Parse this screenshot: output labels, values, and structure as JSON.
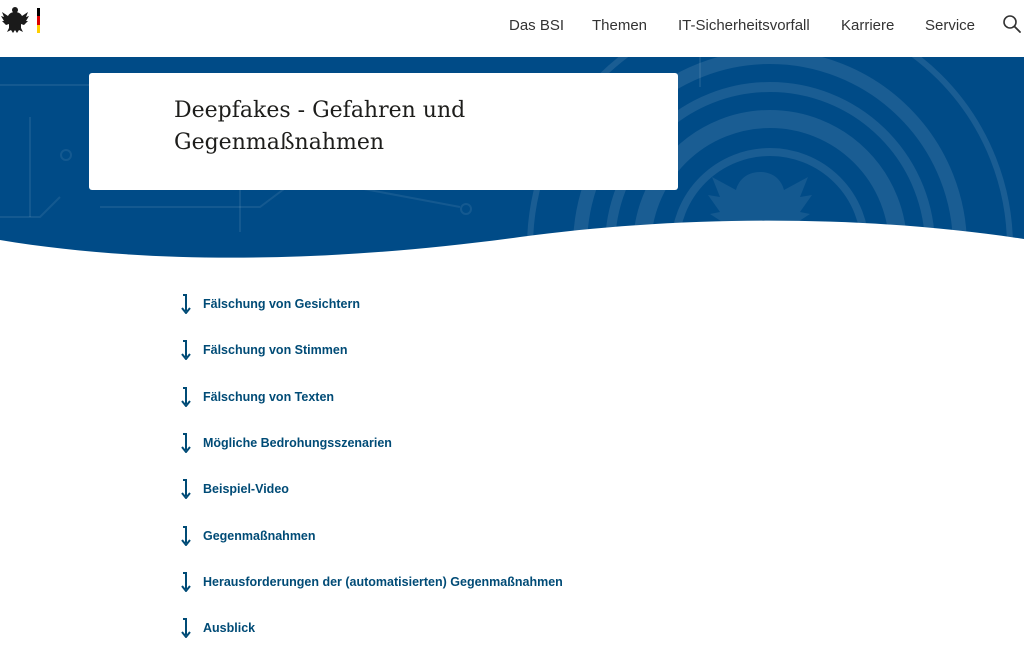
{
  "header": {
    "logo_icon": "federal-eagle-icon",
    "nav": [
      {
        "label": "Das BSI"
      },
      {
        "label": "Themen"
      },
      {
        "label": "IT-Sicherheitsvorfall"
      },
      {
        "label": "Karriere"
      },
      {
        "label": "Service"
      }
    ],
    "search_icon": "search-icon"
  },
  "hero": {
    "title": "Deepfakes - Gefahren und Gegenmaßnahmen",
    "background_color": "#004b87"
  },
  "anchors": {
    "arrow_icon": "arrow-down-icon",
    "color": "#004b76",
    "items": [
      {
        "label": "Fälschung von Gesichtern"
      },
      {
        "label": "Fälschung von Stimmen"
      },
      {
        "label": "Fälschung von Texten"
      },
      {
        "label": "Mögliche Bedrohungsszenarien"
      },
      {
        "label": "Beispiel-Video"
      },
      {
        "label": "Gegenmaßnahmen"
      },
      {
        "label": "Herausforderungen der (automatisierten) Gegenmaßnahmen"
      },
      {
        "label": "Ausblick"
      }
    ]
  }
}
